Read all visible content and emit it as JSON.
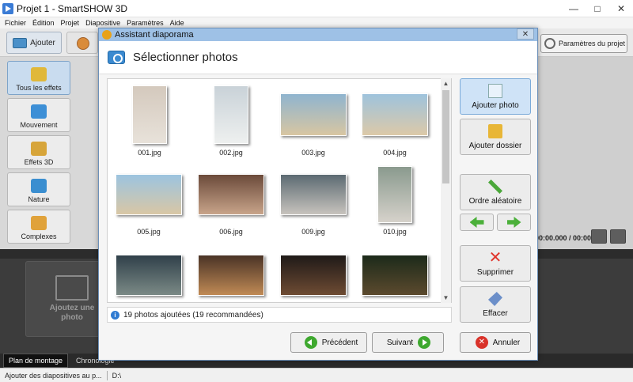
{
  "window": {
    "title": "Projet 1 - SmartSHOW 3D",
    "minimize": "—",
    "maximize": "□",
    "close": "✕"
  },
  "menu": [
    "Fichier",
    "Édition",
    "Projet",
    "Diapositive",
    "Paramètres",
    "Aide"
  ],
  "toolbar": {
    "add_tab": "Ajouter",
    "project_settings": "Paramètres du projet"
  },
  "effects": [
    "Tous les effets",
    "Mouvement",
    "Effets 3D",
    "Nature",
    "Complexes"
  ],
  "timeline": {
    "add_photo": "Ajoutez une photo",
    "timecode": "00:00.000 / 00:00.000"
  },
  "bottom_tabs": [
    "Plan de montage",
    "Chronologie"
  ],
  "statusbar": {
    "hint": "Ajouter des diapositives au p...",
    "drive": "D:\\"
  },
  "dialog": {
    "title": "Assistant diaporama",
    "close": "✕",
    "heading": "Sélectionner photos",
    "photos": [
      {
        "name": "001.jpg",
        "colors": [
          "#d4c9bd",
          "#e8e2da"
        ]
      },
      {
        "name": "002.jpg",
        "colors": [
          "#c9d2d8",
          "#eef0ef"
        ]
      },
      {
        "name": "003.jpg",
        "colors": [
          "#8fb4cf",
          "#d8c6a2"
        ]
      },
      {
        "name": "004.jpg",
        "colors": [
          "#9ec3dd",
          "#dcc9a8"
        ]
      },
      {
        "name": "005.jpg",
        "colors": [
          "#9cc4e0",
          "#d9c7a5"
        ]
      },
      {
        "name": "006.jpg",
        "colors": [
          "#6b4a3a",
          "#c8a48a"
        ]
      },
      {
        "name": "009.jpg",
        "colors": [
          "#5c6a72",
          "#c7c3bd"
        ]
      },
      {
        "name": "010.jpg",
        "colors": [
          "#8a9a8e",
          "#d6d2cb"
        ]
      },
      {
        "name": "",
        "colors": [
          "#30404a",
          "#7b8a86"
        ]
      },
      {
        "name": "",
        "colors": [
          "#4a3326",
          "#c08a55"
        ]
      },
      {
        "name": "",
        "colors": [
          "#1f1a18",
          "#6e4b33"
        ]
      },
      {
        "name": "",
        "colors": [
          "#1c2a1a",
          "#5c4a2e"
        ]
      }
    ],
    "info": "19 photos ajoutées (19 recommandées)",
    "side_buttons": {
      "add_photo": "Ajouter photo",
      "add_folder": "Ajouter dossier",
      "shuffle": "Ordre aléatoire",
      "delete": "Supprimer",
      "clear": "Effacer"
    },
    "nav": {
      "previous": "Précédent",
      "next": "Suivant",
      "cancel": "Annuler"
    }
  }
}
